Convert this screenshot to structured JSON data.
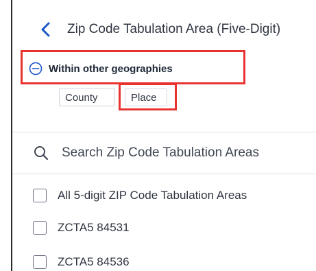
{
  "header": {
    "title": "Zip Code Tabulation Area (Five-Digit)"
  },
  "geographies": {
    "label": "Within other geographies",
    "chips": [
      {
        "label": "County"
      },
      {
        "label": "Place"
      }
    ]
  },
  "search": {
    "placeholder": "Search Zip Code Tabulation Areas"
  },
  "list": {
    "items": [
      {
        "label": "All 5-digit ZIP Code Tabulation Areas",
        "checked": false
      },
      {
        "label": "ZCTA5 84531",
        "checked": false
      },
      {
        "label": "ZCTA5 84536",
        "checked": false
      }
    ]
  },
  "colors": {
    "accent": "#1a56c8",
    "highlight": "#e8322f",
    "text": "#2e3440"
  },
  "icons": {
    "back": "chevron-left-icon",
    "collapse": "minus-circle-icon",
    "search": "search-icon"
  }
}
